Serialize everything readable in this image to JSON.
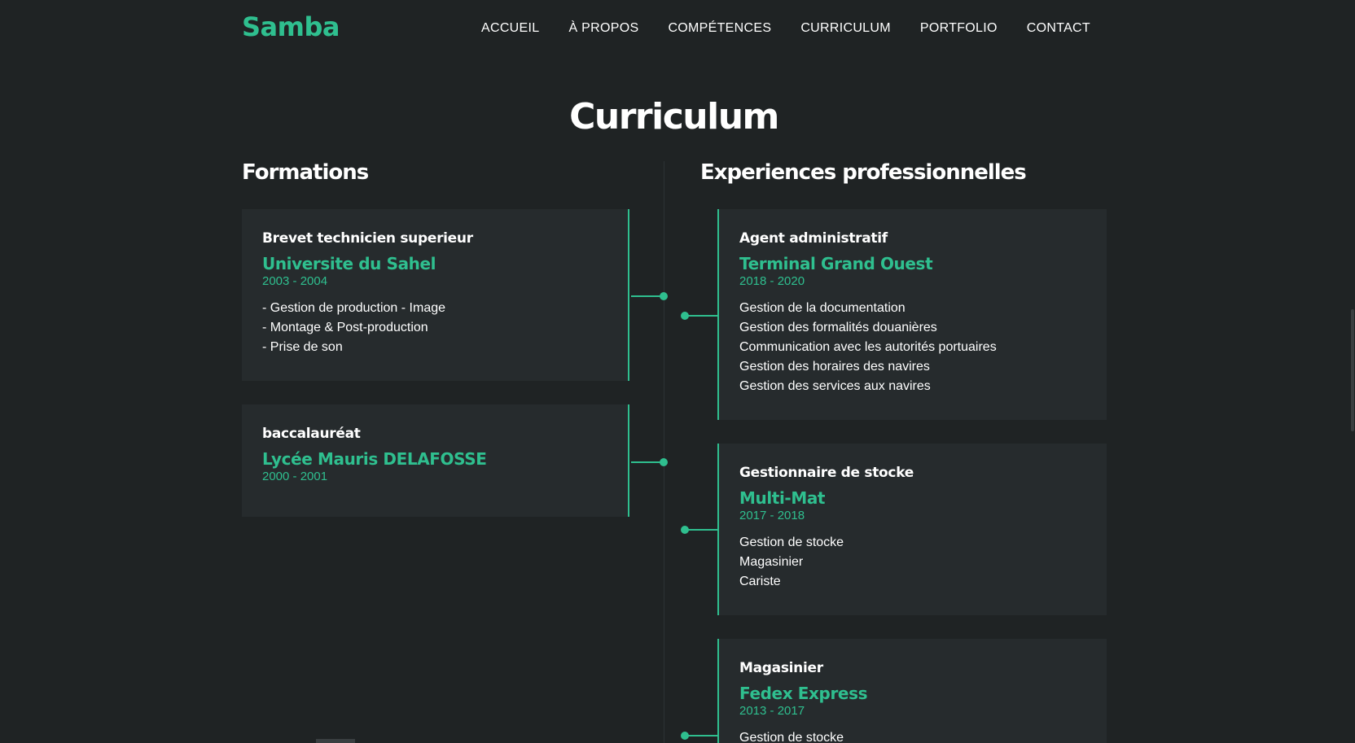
{
  "header": {
    "logo": "Samba",
    "nav": [
      "ACCUEIL",
      "À PROPOS",
      "COMPÉTENCES",
      "CURRICULUM",
      "PORTFOLIO",
      "CONTACT"
    ]
  },
  "page_title": "Curriculum",
  "formations": {
    "title": "Formations",
    "items": [
      {
        "role": "Brevet technicien superieur",
        "org": "Universite du Sahel",
        "dates": "2003 - 2004",
        "details": [
          "- Gestion de production - Image",
          "- Montage & Post-production",
          "- Prise de son"
        ]
      },
      {
        "role": "baccalauréat",
        "org": "Lycée Mauris DELAFOSSE",
        "dates": "2000 - 2001",
        "details": []
      }
    ]
  },
  "experiences": {
    "title": "Experiences professionnelles",
    "items": [
      {
        "role": "Agent administratif",
        "org": "Terminal Grand Ouest",
        "dates": "2018 - 2020",
        "details": [
          "Gestion de la documentation",
          "Gestion des formalités douanières",
          "Communication avec les autorités portuaires",
          "Gestion des horaires des navires",
          "Gestion des services aux navires"
        ]
      },
      {
        "role": "Gestionnaire de stocke",
        "org": "Multi-Mat",
        "dates": "2017 - 2018",
        "details": [
          "Gestion de stocke",
          "Magasinier",
          "Cariste"
        ]
      },
      {
        "role": "Magasinier",
        "org": "Fedex Express",
        "dates": "2013 - 2017",
        "details": [
          "Gestion de stocke"
        ]
      }
    ]
  },
  "colors": {
    "background": "#1f2324",
    "card": "#262b2d",
    "accent": "#2fbf8f"
  }
}
